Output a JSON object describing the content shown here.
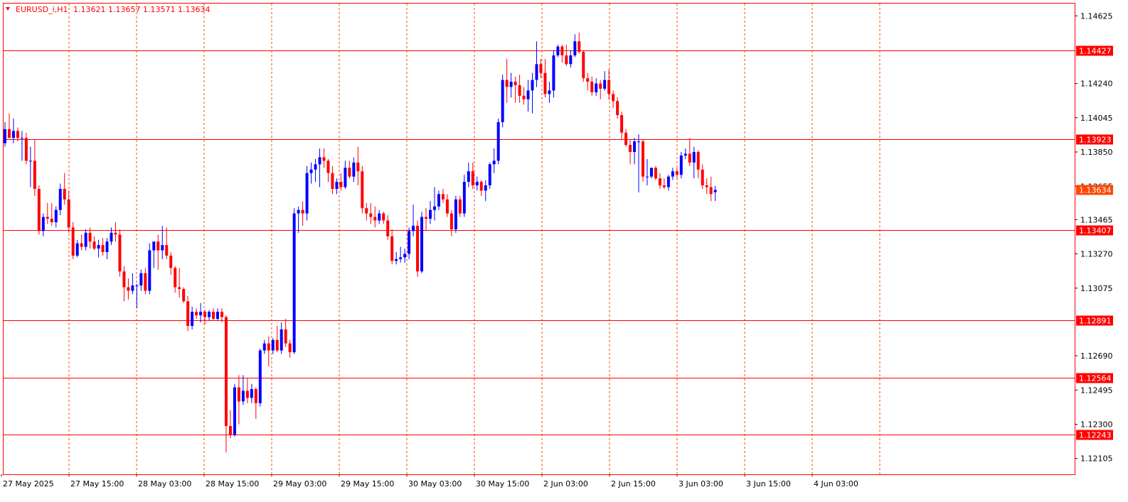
{
  "header": {
    "symbol": "EURUSD_i,H1",
    "ohlc": "1.13621 1.13657 1.13571 1.13634",
    "indicator_icon": "triangle-down-icon"
  },
  "colors": {
    "background": "#ffffff",
    "frame": "#ff0000",
    "grid": "#ff4500",
    "bull": "#0000ff",
    "bear": "#ff0000",
    "level_line": "#ff0000",
    "current_label": "#ff4500"
  },
  "chart_data": {
    "type": "candlestick",
    "title": "EURUSD_i,H1",
    "timeframe": "H1",
    "ylim": [
      1.12015,
      1.14695
    ],
    "y_ticks": [
      1.14625,
      1.1424,
      1.14045,
      1.1385,
      1.13655,
      1.13465,
      1.1327,
      1.13075,
      1.1269,
      1.12495,
      1.123,
      1.12105
    ],
    "x_ticks": [
      "27 May 2025",
      "27 May 15:00",
      "28 May 03:00",
      "28 May 15:00",
      "29 May 03:00",
      "29 May 15:00",
      "30 May 03:00",
      "30 May 15:00",
      "2 Jun 03:00",
      "2 Jun 15:00",
      "3 Jun 03:00",
      "3 Jun 15:00",
      "4 Jun 03:00"
    ],
    "levels": [
      1.14427,
      1.13923,
      1.13407,
      1.12891,
      1.12564,
      1.12243
    ],
    "current_price": 1.13634,
    "candles": [
      {
        "o": 1.139,
        "h": 1.1402,
        "l": 1.1388,
        "c": 1.1398
      },
      {
        "o": 1.1398,
        "h": 1.1407,
        "l": 1.1393,
        "c": 1.1393
      },
      {
        "o": 1.1393,
        "h": 1.1404,
        "l": 1.139,
        "c": 1.1397
      },
      {
        "o": 1.1397,
        "h": 1.1399,
        "l": 1.1391,
        "c": 1.1393
      },
      {
        "o": 1.1393,
        "h": 1.1397,
        "l": 1.138,
        "c": 1.1393
      },
      {
        "o": 1.1393,
        "h": 1.1396,
        "l": 1.1378,
        "c": 1.138
      },
      {
        "o": 1.138,
        "h": 1.1388,
        "l": 1.1365,
        "c": 1.138
      },
      {
        "o": 1.138,
        "h": 1.1392,
        "l": 1.136,
        "c": 1.1364
      },
      {
        "o": 1.1364,
        "h": 1.1366,
        "l": 1.1338,
        "c": 1.134
      },
      {
        "o": 1.134,
        "h": 1.135,
        "l": 1.1337,
        "c": 1.1348
      },
      {
        "o": 1.1348,
        "h": 1.1356,
        "l": 1.1344,
        "c": 1.1347
      },
      {
        "o": 1.1347,
        "h": 1.1356,
        "l": 1.1343,
        "c": 1.1345
      },
      {
        "o": 1.1345,
        "h": 1.1354,
        "l": 1.1342,
        "c": 1.1352
      },
      {
        "o": 1.1352,
        "h": 1.1367,
        "l": 1.1349,
        "c": 1.1364
      },
      {
        "o": 1.1364,
        "h": 1.1373,
        "l": 1.1355,
        "c": 1.1358
      },
      {
        "o": 1.1358,
        "h": 1.1363,
        "l": 1.1339,
        "c": 1.1342
      },
      {
        "o": 1.1342,
        "h": 1.1345,
        "l": 1.1324,
        "c": 1.1326
      },
      {
        "o": 1.1326,
        "h": 1.1335,
        "l": 1.1325,
        "c": 1.1333
      },
      {
        "o": 1.1333,
        "h": 1.1338,
        "l": 1.1329,
        "c": 1.1331
      },
      {
        "o": 1.1331,
        "h": 1.1341,
        "l": 1.1329,
        "c": 1.1339
      },
      {
        "o": 1.1339,
        "h": 1.1342,
        "l": 1.133,
        "c": 1.1334
      },
      {
        "o": 1.1334,
        "h": 1.1337,
        "l": 1.1329,
        "c": 1.133
      },
      {
        "o": 1.133,
        "h": 1.1335,
        "l": 1.1325,
        "c": 1.1332
      },
      {
        "o": 1.1332,
        "h": 1.1336,
        "l": 1.1326,
        "c": 1.1328
      },
      {
        "o": 1.1328,
        "h": 1.1336,
        "l": 1.1324,
        "c": 1.1334
      },
      {
        "o": 1.1334,
        "h": 1.1342,
        "l": 1.1332,
        "c": 1.1339
      },
      {
        "o": 1.1339,
        "h": 1.1345,
        "l": 1.1334,
        "c": 1.1338
      },
      {
        "o": 1.1338,
        "h": 1.1341,
        "l": 1.1314,
        "c": 1.1317
      },
      {
        "o": 1.1317,
        "h": 1.132,
        "l": 1.13,
        "c": 1.1308
      },
      {
        "o": 1.1308,
        "h": 1.1313,
        "l": 1.1301,
        "c": 1.1306
      },
      {
        "o": 1.1306,
        "h": 1.1316,
        "l": 1.1304,
        "c": 1.1309
      },
      {
        "o": 1.1309,
        "h": 1.131,
        "l": 1.1296,
        "c": 1.1309
      },
      {
        "o": 1.1309,
        "h": 1.1318,
        "l": 1.1306,
        "c": 1.1316
      },
      {
        "o": 1.1316,
        "h": 1.1319,
        "l": 1.1304,
        "c": 1.1306
      },
      {
        "o": 1.1306,
        "h": 1.1333,
        "l": 1.1304,
        "c": 1.1329
      },
      {
        "o": 1.1329,
        "h": 1.1334,
        "l": 1.1319,
        "c": 1.1334
      },
      {
        "o": 1.1334,
        "h": 1.1338,
        "l": 1.1318,
        "c": 1.1329
      },
      {
        "o": 1.1329,
        "h": 1.1343,
        "l": 1.1324,
        "c": 1.1332
      },
      {
        "o": 1.1332,
        "h": 1.1342,
        "l": 1.1324,
        "c": 1.1326
      },
      {
        "o": 1.1326,
        "h": 1.1328,
        "l": 1.1315,
        "c": 1.1319
      },
      {
        "o": 1.1319,
        "h": 1.132,
        "l": 1.1305,
        "c": 1.1308
      },
      {
        "o": 1.1308,
        "h": 1.1319,
        "l": 1.1302,
        "c": 1.1307
      },
      {
        "o": 1.1307,
        "h": 1.1308,
        "l": 1.1299,
        "c": 1.13
      },
      {
        "o": 1.13,
        "h": 1.1303,
        "l": 1.1283,
        "c": 1.1286
      },
      {
        "o": 1.1286,
        "h": 1.1297,
        "l": 1.1284,
        "c": 1.1294
      },
      {
        "o": 1.1294,
        "h": 1.1296,
        "l": 1.129,
        "c": 1.1292
      },
      {
        "o": 1.1292,
        "h": 1.1299,
        "l": 1.1288,
        "c": 1.1294
      },
      {
        "o": 1.1294,
        "h": 1.1295,
        "l": 1.1287,
        "c": 1.1291
      },
      {
        "o": 1.1291,
        "h": 1.1295,
        "l": 1.1289,
        "c": 1.1294
      },
      {
        "o": 1.1294,
        "h": 1.1296,
        "l": 1.1289,
        "c": 1.129
      },
      {
        "o": 1.129,
        "h": 1.1296,
        "l": 1.1289,
        "c": 1.1294
      },
      {
        "o": 1.1294,
        "h": 1.1296,
        "l": 1.1288,
        "c": 1.1291
      },
      {
        "o": 1.1291,
        "h": 1.1292,
        "l": 1.1214,
        "c": 1.1229
      },
      {
        "o": 1.1229,
        "h": 1.1238,
        "l": 1.1222,
        "c": 1.1224
      },
      {
        "o": 1.1224,
        "h": 1.1253,
        "l": 1.1223,
        "c": 1.1251
      },
      {
        "o": 1.1251,
        "h": 1.1258,
        "l": 1.123,
        "c": 1.1243
      },
      {
        "o": 1.1243,
        "h": 1.1258,
        "l": 1.1241,
        "c": 1.1249
      },
      {
        "o": 1.1249,
        "h": 1.1256,
        "l": 1.1242,
        "c": 1.1245
      },
      {
        "o": 1.1245,
        "h": 1.1253,
        "l": 1.1242,
        "c": 1.125
      },
      {
        "o": 1.125,
        "h": 1.1251,
        "l": 1.1233,
        "c": 1.1242
      },
      {
        "o": 1.1242,
        "h": 1.1273,
        "l": 1.124,
        "c": 1.1272
      },
      {
        "o": 1.1272,
        "h": 1.1278,
        "l": 1.127,
        "c": 1.1276
      },
      {
        "o": 1.1276,
        "h": 1.128,
        "l": 1.1263,
        "c": 1.1272
      },
      {
        "o": 1.1272,
        "h": 1.1279,
        "l": 1.127,
        "c": 1.1278
      },
      {
        "o": 1.1278,
        "h": 1.1286,
        "l": 1.1271,
        "c": 1.1272
      },
      {
        "o": 1.1272,
        "h": 1.1288,
        "l": 1.127,
        "c": 1.1284
      },
      {
        "o": 1.1284,
        "h": 1.129,
        "l": 1.1274,
        "c": 1.1276
      },
      {
        "o": 1.1276,
        "h": 1.1278,
        "l": 1.1268,
        "c": 1.1271
      },
      {
        "o": 1.1271,
        "h": 1.1353,
        "l": 1.127,
        "c": 1.135
      },
      {
        "o": 1.135,
        "h": 1.1354,
        "l": 1.1339,
        "c": 1.1352
      },
      {
        "o": 1.1352,
        "h": 1.1357,
        "l": 1.1343,
        "c": 1.135
      },
      {
        "o": 1.135,
        "h": 1.1377,
        "l": 1.1346,
        "c": 1.1373
      },
      {
        "o": 1.1373,
        "h": 1.1379,
        "l": 1.1367,
        "c": 1.1375
      },
      {
        "o": 1.1375,
        "h": 1.1381,
        "l": 1.1368,
        "c": 1.1378
      },
      {
        "o": 1.1378,
        "h": 1.1387,
        "l": 1.1365,
        "c": 1.1382
      },
      {
        "o": 1.1382,
        "h": 1.1387,
        "l": 1.1376,
        "c": 1.138
      },
      {
        "o": 1.138,
        "h": 1.1381,
        "l": 1.1368,
        "c": 1.1373
      },
      {
        "o": 1.1373,
        "h": 1.1377,
        "l": 1.1361,
        "c": 1.1364
      },
      {
        "o": 1.1364,
        "h": 1.137,
        "l": 1.1361,
        "c": 1.1368
      },
      {
        "o": 1.1368,
        "h": 1.1373,
        "l": 1.1363,
        "c": 1.1365
      },
      {
        "o": 1.1365,
        "h": 1.138,
        "l": 1.1364,
        "c": 1.1376
      },
      {
        "o": 1.1376,
        "h": 1.138,
        "l": 1.137,
        "c": 1.1371
      },
      {
        "o": 1.1371,
        "h": 1.1382,
        "l": 1.1368,
        "c": 1.1379
      },
      {
        "o": 1.1379,
        "h": 1.1388,
        "l": 1.1366,
        "c": 1.1374
      },
      {
        "o": 1.1374,
        "h": 1.1377,
        "l": 1.135,
        "c": 1.1353
      },
      {
        "o": 1.1353,
        "h": 1.1356,
        "l": 1.1346,
        "c": 1.135
      },
      {
        "o": 1.135,
        "h": 1.1356,
        "l": 1.1344,
        "c": 1.1348
      },
      {
        "o": 1.1348,
        "h": 1.1354,
        "l": 1.1342,
        "c": 1.1346
      },
      {
        "o": 1.1346,
        "h": 1.1352,
        "l": 1.1344,
        "c": 1.135
      },
      {
        "o": 1.135,
        "h": 1.1351,
        "l": 1.1344,
        "c": 1.1346
      },
      {
        "o": 1.1346,
        "h": 1.1349,
        "l": 1.1335,
        "c": 1.1337
      },
      {
        "o": 1.1337,
        "h": 1.1341,
        "l": 1.1321,
        "c": 1.1323
      },
      {
        "o": 1.1323,
        "h": 1.1328,
        "l": 1.1321,
        "c": 1.1324
      },
      {
        "o": 1.1324,
        "h": 1.1331,
        "l": 1.1322,
        "c": 1.1325
      },
      {
        "o": 1.1325,
        "h": 1.133,
        "l": 1.1322,
        "c": 1.1327
      },
      {
        "o": 1.1327,
        "h": 1.1342,
        "l": 1.1324,
        "c": 1.134
      },
      {
        "o": 1.134,
        "h": 1.1355,
        "l": 1.1337,
        "c": 1.1343
      },
      {
        "o": 1.1343,
        "h": 1.1346,
        "l": 1.1314,
        "c": 1.1317
      },
      {
        "o": 1.1317,
        "h": 1.1351,
        "l": 1.1316,
        "c": 1.1348
      },
      {
        "o": 1.1348,
        "h": 1.1353,
        "l": 1.134,
        "c": 1.1347
      },
      {
        "o": 1.1347,
        "h": 1.1357,
        "l": 1.1344,
        "c": 1.1352
      },
      {
        "o": 1.1352,
        "h": 1.1365,
        "l": 1.1346,
        "c": 1.1354
      },
      {
        "o": 1.1354,
        "h": 1.1363,
        "l": 1.1352,
        "c": 1.1361
      },
      {
        "o": 1.1361,
        "h": 1.1364,
        "l": 1.1356,
        "c": 1.1358
      },
      {
        "o": 1.1358,
        "h": 1.1361,
        "l": 1.1348,
        "c": 1.135
      },
      {
        "o": 1.135,
        "h": 1.1352,
        "l": 1.1337,
        "c": 1.1341
      },
      {
        "o": 1.1341,
        "h": 1.136,
        "l": 1.1339,
        "c": 1.1358
      },
      {
        "o": 1.1358,
        "h": 1.136,
        "l": 1.1348,
        "c": 1.135
      },
      {
        "o": 1.135,
        "h": 1.1372,
        "l": 1.1348,
        "c": 1.1368
      },
      {
        "o": 1.1368,
        "h": 1.1379,
        "l": 1.1365,
        "c": 1.1374
      },
      {
        "o": 1.1374,
        "h": 1.1379,
        "l": 1.1364,
        "c": 1.1366
      },
      {
        "o": 1.1366,
        "h": 1.1371,
        "l": 1.1363,
        "c": 1.1368
      },
      {
        "o": 1.1368,
        "h": 1.1369,
        "l": 1.136,
        "c": 1.1363
      },
      {
        "o": 1.1363,
        "h": 1.1369,
        "l": 1.1357,
        "c": 1.1366
      },
      {
        "o": 1.1366,
        "h": 1.1379,
        "l": 1.1364,
        "c": 1.1378
      },
      {
        "o": 1.1378,
        "h": 1.1387,
        "l": 1.1373,
        "c": 1.138
      },
      {
        "o": 1.138,
        "h": 1.1404,
        "l": 1.1378,
        "c": 1.1402
      },
      {
        "o": 1.1402,
        "h": 1.1429,
        "l": 1.1399,
        "c": 1.1426
      },
      {
        "o": 1.1426,
        "h": 1.1438,
        "l": 1.1413,
        "c": 1.1422
      },
      {
        "o": 1.1422,
        "h": 1.143,
        "l": 1.1416,
        "c": 1.1425
      },
      {
        "o": 1.1425,
        "h": 1.1428,
        "l": 1.1413,
        "c": 1.1423
      },
      {
        "o": 1.1423,
        "h": 1.1429,
        "l": 1.1413,
        "c": 1.1417
      },
      {
        "o": 1.1417,
        "h": 1.1422,
        "l": 1.1412,
        "c": 1.1415
      },
      {
        "o": 1.1415,
        "h": 1.1426,
        "l": 1.1408,
        "c": 1.142
      },
      {
        "o": 1.142,
        "h": 1.143,
        "l": 1.1407,
        "c": 1.1426
      },
      {
        "o": 1.1426,
        "h": 1.1448,
        "l": 1.1422,
        "c": 1.1435
      },
      {
        "o": 1.1435,
        "h": 1.1438,
        "l": 1.1427,
        "c": 1.143
      },
      {
        "o": 1.143,
        "h": 1.1438,
        "l": 1.1416,
        "c": 1.1418
      },
      {
        "o": 1.1418,
        "h": 1.1425,
        "l": 1.1413,
        "c": 1.142
      },
      {
        "o": 1.142,
        "h": 1.1443,
        "l": 1.1416,
        "c": 1.144
      },
      {
        "o": 1.144,
        "h": 1.1446,
        "l": 1.1439,
        "c": 1.1445
      },
      {
        "o": 1.1445,
        "h": 1.1446,
        "l": 1.1436,
        "c": 1.144
      },
      {
        "o": 1.144,
        "h": 1.1446,
        "l": 1.1434,
        "c": 1.1435
      },
      {
        "o": 1.1435,
        "h": 1.1443,
        "l": 1.1433,
        "c": 1.144
      },
      {
        "o": 1.144,
        "h": 1.1452,
        "l": 1.1439,
        "c": 1.1448
      },
      {
        "o": 1.1448,
        "h": 1.1453,
        "l": 1.1441,
        "c": 1.1442
      },
      {
        "o": 1.1442,
        "h": 1.1443,
        "l": 1.1425,
        "c": 1.1427
      },
      {
        "o": 1.1427,
        "h": 1.143,
        "l": 1.142,
        "c": 1.1425
      },
      {
        "o": 1.1425,
        "h": 1.1428,
        "l": 1.1417,
        "c": 1.1419
      },
      {
        "o": 1.1419,
        "h": 1.1427,
        "l": 1.1417,
        "c": 1.1424
      },
      {
        "o": 1.1424,
        "h": 1.1426,
        "l": 1.1415,
        "c": 1.1421
      },
      {
        "o": 1.1421,
        "h": 1.1431,
        "l": 1.142,
        "c": 1.1426
      },
      {
        "o": 1.1426,
        "h": 1.1432,
        "l": 1.1415,
        "c": 1.1418
      },
      {
        "o": 1.1418,
        "h": 1.142,
        "l": 1.141,
        "c": 1.1414
      },
      {
        "o": 1.1414,
        "h": 1.1416,
        "l": 1.1404,
        "c": 1.1406
      },
      {
        "o": 1.1406,
        "h": 1.1408,
        "l": 1.1392,
        "c": 1.1396
      },
      {
        "o": 1.1396,
        "h": 1.1398,
        "l": 1.1388,
        "c": 1.1389
      },
      {
        "o": 1.1389,
        "h": 1.1392,
        "l": 1.1378,
        "c": 1.1385
      },
      {
        "o": 1.1385,
        "h": 1.1393,
        "l": 1.1378,
        "c": 1.1391
      },
      {
        "o": 1.1391,
        "h": 1.1395,
        "l": 1.1362,
        "c": 1.1391
      },
      {
        "o": 1.1391,
        "h": 1.1392,
        "l": 1.1368,
        "c": 1.1371
      },
      {
        "o": 1.1371,
        "h": 1.1381,
        "l": 1.1366,
        "c": 1.1371
      },
      {
        "o": 1.1371,
        "h": 1.1376,
        "l": 1.137,
        "c": 1.1376
      },
      {
        "o": 1.1376,
        "h": 1.1377,
        "l": 1.1369,
        "c": 1.137
      },
      {
        "o": 1.137,
        "h": 1.1373,
        "l": 1.1364,
        "c": 1.1366
      },
      {
        "o": 1.1366,
        "h": 1.137,
        "l": 1.1364,
        "c": 1.1365
      },
      {
        "o": 1.1365,
        "h": 1.1372,
        "l": 1.1363,
        "c": 1.1371
      },
      {
        "o": 1.1371,
        "h": 1.1376,
        "l": 1.1369,
        "c": 1.1374
      },
      {
        "o": 1.1374,
        "h": 1.1376,
        "l": 1.137,
        "c": 1.1372
      },
      {
        "o": 1.1372,
        "h": 1.1385,
        "l": 1.137,
        "c": 1.1383
      },
      {
        "o": 1.1383,
        "h": 1.1387,
        "l": 1.1381,
        "c": 1.1384
      },
      {
        "o": 1.1384,
        "h": 1.1393,
        "l": 1.1377,
        "c": 1.1379
      },
      {
        "o": 1.1379,
        "h": 1.1388,
        "l": 1.137,
        "c": 1.1385
      },
      {
        "o": 1.1385,
        "h": 1.1386,
        "l": 1.137,
        "c": 1.1375
      },
      {
        "o": 1.1375,
        "h": 1.1378,
        "l": 1.1364,
        "c": 1.1366
      },
      {
        "o": 1.1366,
        "h": 1.137,
        "l": 1.1361,
        "c": 1.1365
      },
      {
        "o": 1.1365,
        "h": 1.1371,
        "l": 1.1357,
        "c": 1.1361
      },
      {
        "o": 1.13621,
        "h": 1.13657,
        "l": 1.13571,
        "c": 1.13634
      }
    ]
  }
}
